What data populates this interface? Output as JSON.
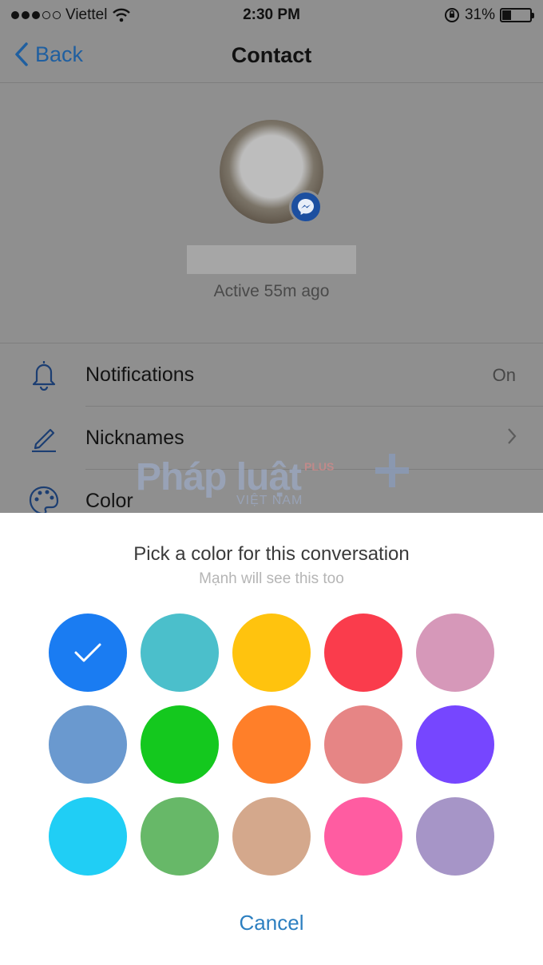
{
  "status_bar": {
    "carrier": "Viettel",
    "signal_bars": 5,
    "signal_filled": 3,
    "time": "2:30 PM",
    "battery": "31%",
    "battery_level": 0.31
  },
  "nav": {
    "back_label": "Back",
    "title": "Contact"
  },
  "profile": {
    "active_status": "Active 55m ago"
  },
  "settings": [
    {
      "icon": "bell-icon",
      "label": "Notifications",
      "value": "On",
      "accessory": ""
    },
    {
      "icon": "pencil-icon",
      "label": "Nicknames",
      "value": "",
      "accessory": "chevron"
    },
    {
      "icon": "palette-icon",
      "label": "Color",
      "value": "",
      "accessory": ""
    }
  ],
  "watermark": {
    "main": "Pháp luật",
    "plus": "PLUS",
    "sub": "VIỆT NAM"
  },
  "color_picker": {
    "title": "Pick a color for this conversation",
    "subtitle": "Mạnh will see this too",
    "selected_index": 0,
    "colors": [
      "#1a7cf2",
      "#4bbfcb",
      "#ffc30e",
      "#fa3c4c",
      "#d698b9",
      "#6a99cf",
      "#14c81e",
      "#ff7f29",
      "#e68585",
      "#7646ff",
      "#20cef5",
      "#67b868",
      "#d4a88c",
      "#ff5ca1",
      "#a695c7"
    ],
    "cancel_label": "Cancel"
  }
}
